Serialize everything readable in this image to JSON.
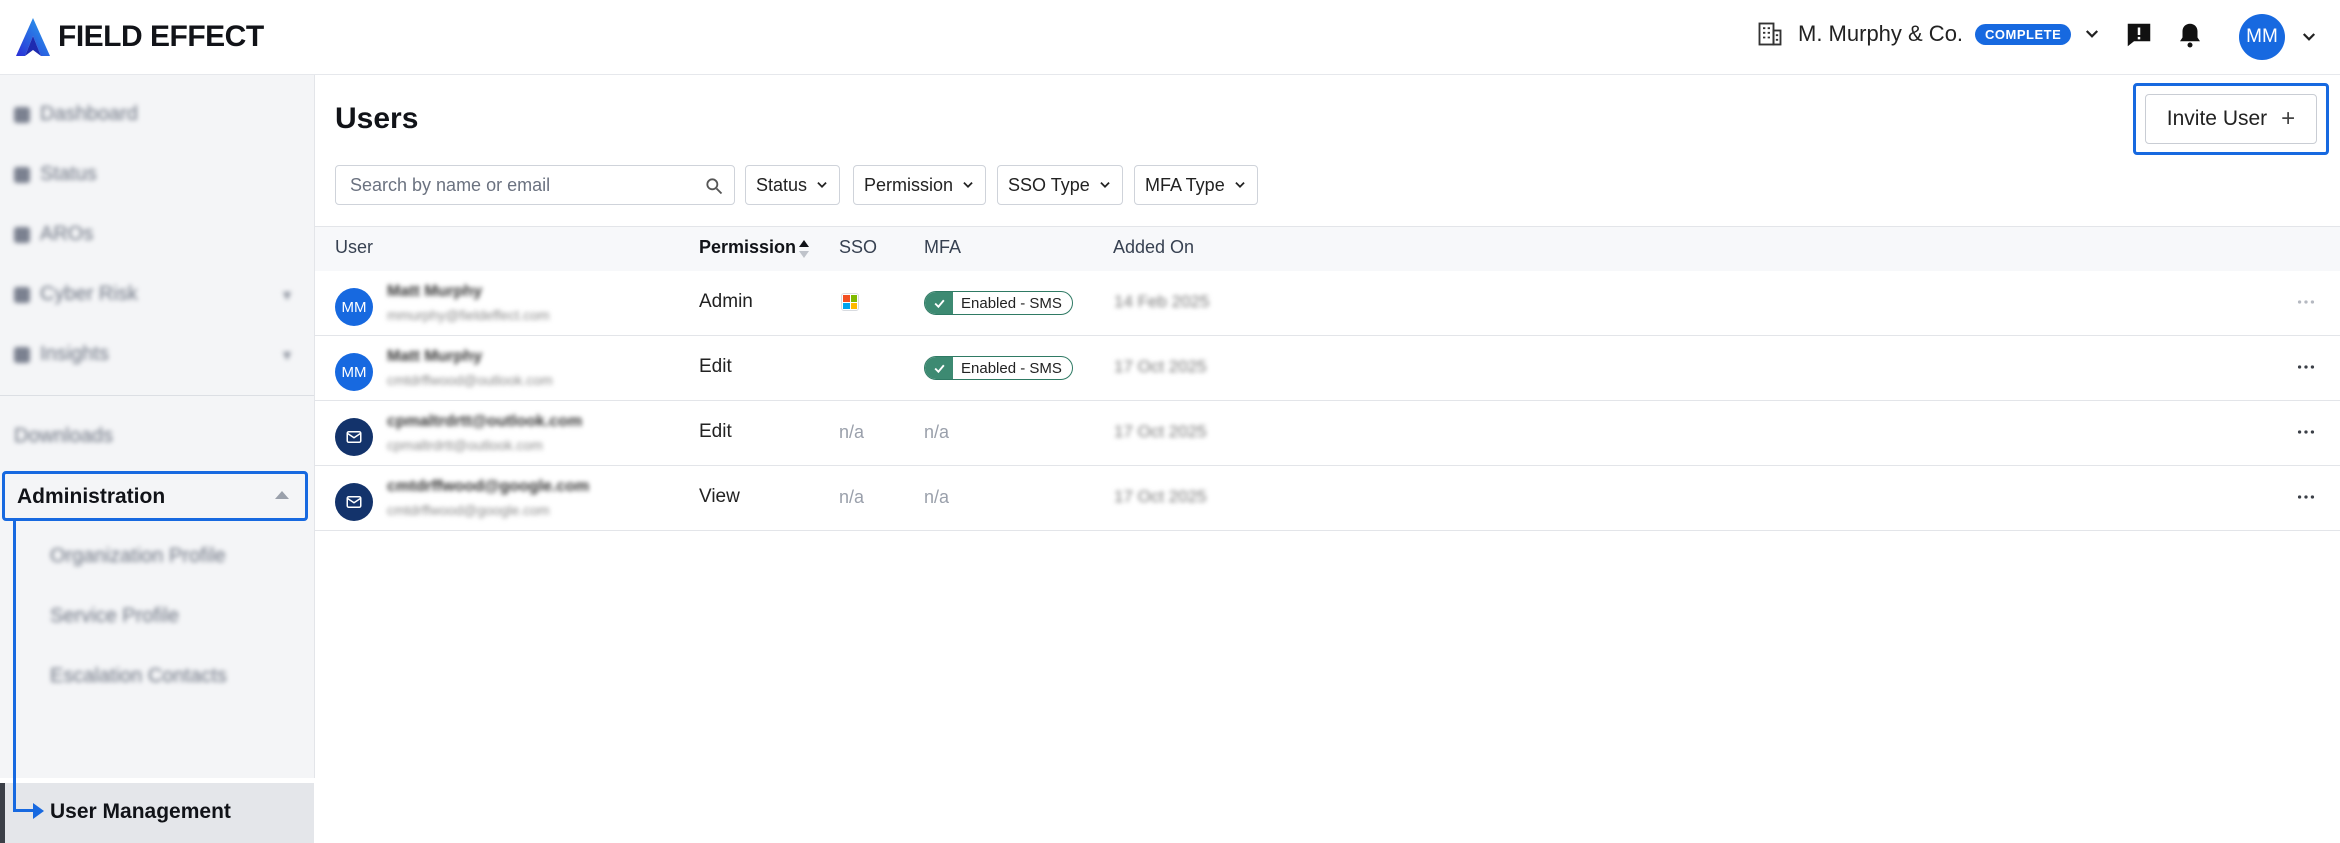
{
  "header": {
    "brand_name": "FIELD EFFECT",
    "org_name": "M. Murphy & Co.",
    "org_badge": "COMPLETE",
    "user_initials": "MM"
  },
  "sidebar": {
    "items": [
      {
        "label": "Dashboard"
      },
      {
        "label": "Status"
      },
      {
        "label": "AROs"
      },
      {
        "label": "Cyber Risk"
      },
      {
        "label": "Insights"
      }
    ],
    "downloads_label": "Downloads",
    "administration_label": "Administration",
    "admin_items": [
      {
        "label": "Organization Profile"
      },
      {
        "label": "Service Profile"
      },
      {
        "label": "Escalation Contacts"
      }
    ],
    "active_item_label": "User Management"
  },
  "main": {
    "title": "Users",
    "invite_label": "Invite User",
    "search_placeholder": "Search by name or email",
    "filters": [
      "Status",
      "Permission",
      "SSO Type",
      "MFA Type"
    ]
  },
  "table": {
    "columns": [
      "User",
      "Permission",
      "SSO",
      "MFA",
      "Added On"
    ],
    "rows": [
      {
        "initials": "MM",
        "avatar_type": "initials",
        "name": "Matt Murphy",
        "email": "mmurphy@fieldeffect.com",
        "permission": "Admin",
        "sso": "microsoft",
        "mfa": "Enabled - SMS",
        "added_on": "14 Feb 2025"
      },
      {
        "initials": "MM",
        "avatar_type": "initials",
        "name": "Matt Murphy",
        "email": "cmtdrffwood@outlook.com",
        "permission": "Edit",
        "sso": "",
        "mfa": "Enabled - SMS",
        "added_on": "17 Oct 2025"
      },
      {
        "initials": "",
        "avatar_type": "mail-icon",
        "name": "cpmaltrdrtt@outlook.com",
        "email": "cpmaltrdrtt@outlook.com",
        "permission": "Edit",
        "sso": "n/a",
        "mfa": "n/a",
        "added_on": "17 Oct 2025"
      },
      {
        "initials": "",
        "avatar_type": "mail-icon",
        "name": "cmtdrffwood@google.com",
        "email": "cmtdrffwood@google.com",
        "permission": "View",
        "sso": "n/a",
        "mfa": "n/a",
        "added_on": "17 Oct 2025"
      }
    ]
  },
  "colors": {
    "accent": "#1769e0",
    "mfa_green": "#3d8a72",
    "navy_avatar": "#13336b"
  }
}
